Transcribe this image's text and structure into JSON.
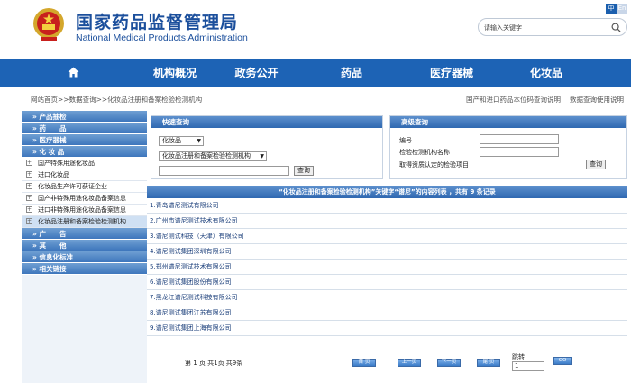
{
  "header": {
    "title_cn": "国家药品监督管理局",
    "title_en": "National Medical Products Administration",
    "lang_zh": "中",
    "lang_en": "En",
    "search_placeholder": "请输入关键字"
  },
  "nav": [
    "机构概况",
    "政务公开",
    "药品",
    "医疗器械",
    "化妆品"
  ],
  "breadcrumb": {
    "items": [
      "网站首页",
      "数据查询",
      "化妆品注册和备案检验检测机构"
    ],
    "separator": ">>",
    "right_links": [
      "国产和进口药品本位码查询说明",
      "数据查询使用说明"
    ]
  },
  "sidebar": {
    "groups": [
      {
        "label": "产品抽检",
        "items": []
      },
      {
        "label": "药　　品",
        "items": []
      },
      {
        "label": "医疗器械",
        "items": []
      },
      {
        "label": "化 妆 品",
        "items": [
          "国产特殊用途化妆品",
          "进口化妆品",
          "化妆品生产许可获证企业",
          "国产非特殊用途化妆品备案信息",
          "进口非特殊用途化妆品备案信息",
          "化妆品注册和备案检验检测机构"
        ]
      },
      {
        "label": "广　　告",
        "items": []
      },
      {
        "label": "其　　他",
        "items": []
      },
      {
        "label": "信息化标准",
        "items": []
      },
      {
        "label": "相关链接",
        "items": []
      }
    ],
    "selected": "化妆品注册和备案检验检测机构"
  },
  "quick": {
    "title": "快速查询",
    "category": "化妆品",
    "database": "化妆品注册和备案检验检测机构",
    "keyword": "",
    "button": "查询"
  },
  "advanced": {
    "title": "高级查询",
    "fields": [
      "编号",
      "检验检测机构名称",
      "取得资质认定的检验项目"
    ],
    "button": "查询"
  },
  "results": {
    "header": "“化妆品注册和备案检验检测机构”关键字“谱尼”的内容列表 ，共有 9 条记录",
    "rows": [
      "1.青岛谱尼测试有限公司",
      "2.广州市谱尼测试技术有限公司",
      "3.谱尼测试科技（天津）有限公司",
      "4.谱尼测试集团深圳有限公司",
      "5.郑州谱尼测试技术有限公司",
      "6.谱尼测试集团股份有限公司",
      "7.黑龙江谱尼测试科技有限公司",
      "8.谱尼测试集团江苏有限公司",
      "9.谱尼测试集团上海有限公司"
    ]
  },
  "pager": {
    "info": "第 1 页 共1页 共9条",
    "first": "首 页",
    "prev": "上一页",
    "next": "下一页",
    "last": "尾 页",
    "jump_label": "跳转",
    "jump_value": "1",
    "go": "GO"
  },
  "colors": {
    "brand": "#1b4f9c",
    "nav": "#1d63b5",
    "panel_head": "#3e76bc"
  }
}
